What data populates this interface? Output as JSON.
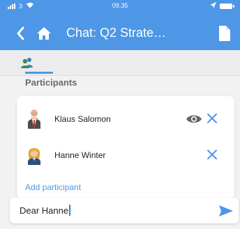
{
  "status_bar": {
    "carrier": "3",
    "time": "09.35"
  },
  "header": {
    "title": "Chat: Q2 Strate…",
    "back_icon": "chevron-left-icon",
    "home_icon": "home-icon",
    "doc_icon": "document-icon"
  },
  "tabs": {
    "active_icon": "participants-icon"
  },
  "section": {
    "title": "Participants"
  },
  "participants": [
    {
      "name": "Klaus Salomon",
      "avatar": "avatar-male-icon",
      "has_view_icon": true
    },
    {
      "name": "Hanne Winter",
      "avatar": "avatar-female-icon",
      "has_view_icon": false
    }
  ],
  "actions": {
    "add_participant": "Add participant"
  },
  "composer": {
    "value": "Dear Hanne",
    "send_icon": "send-icon"
  },
  "colors": {
    "accent": "#4d97e6",
    "background": "#f2f2f2"
  }
}
